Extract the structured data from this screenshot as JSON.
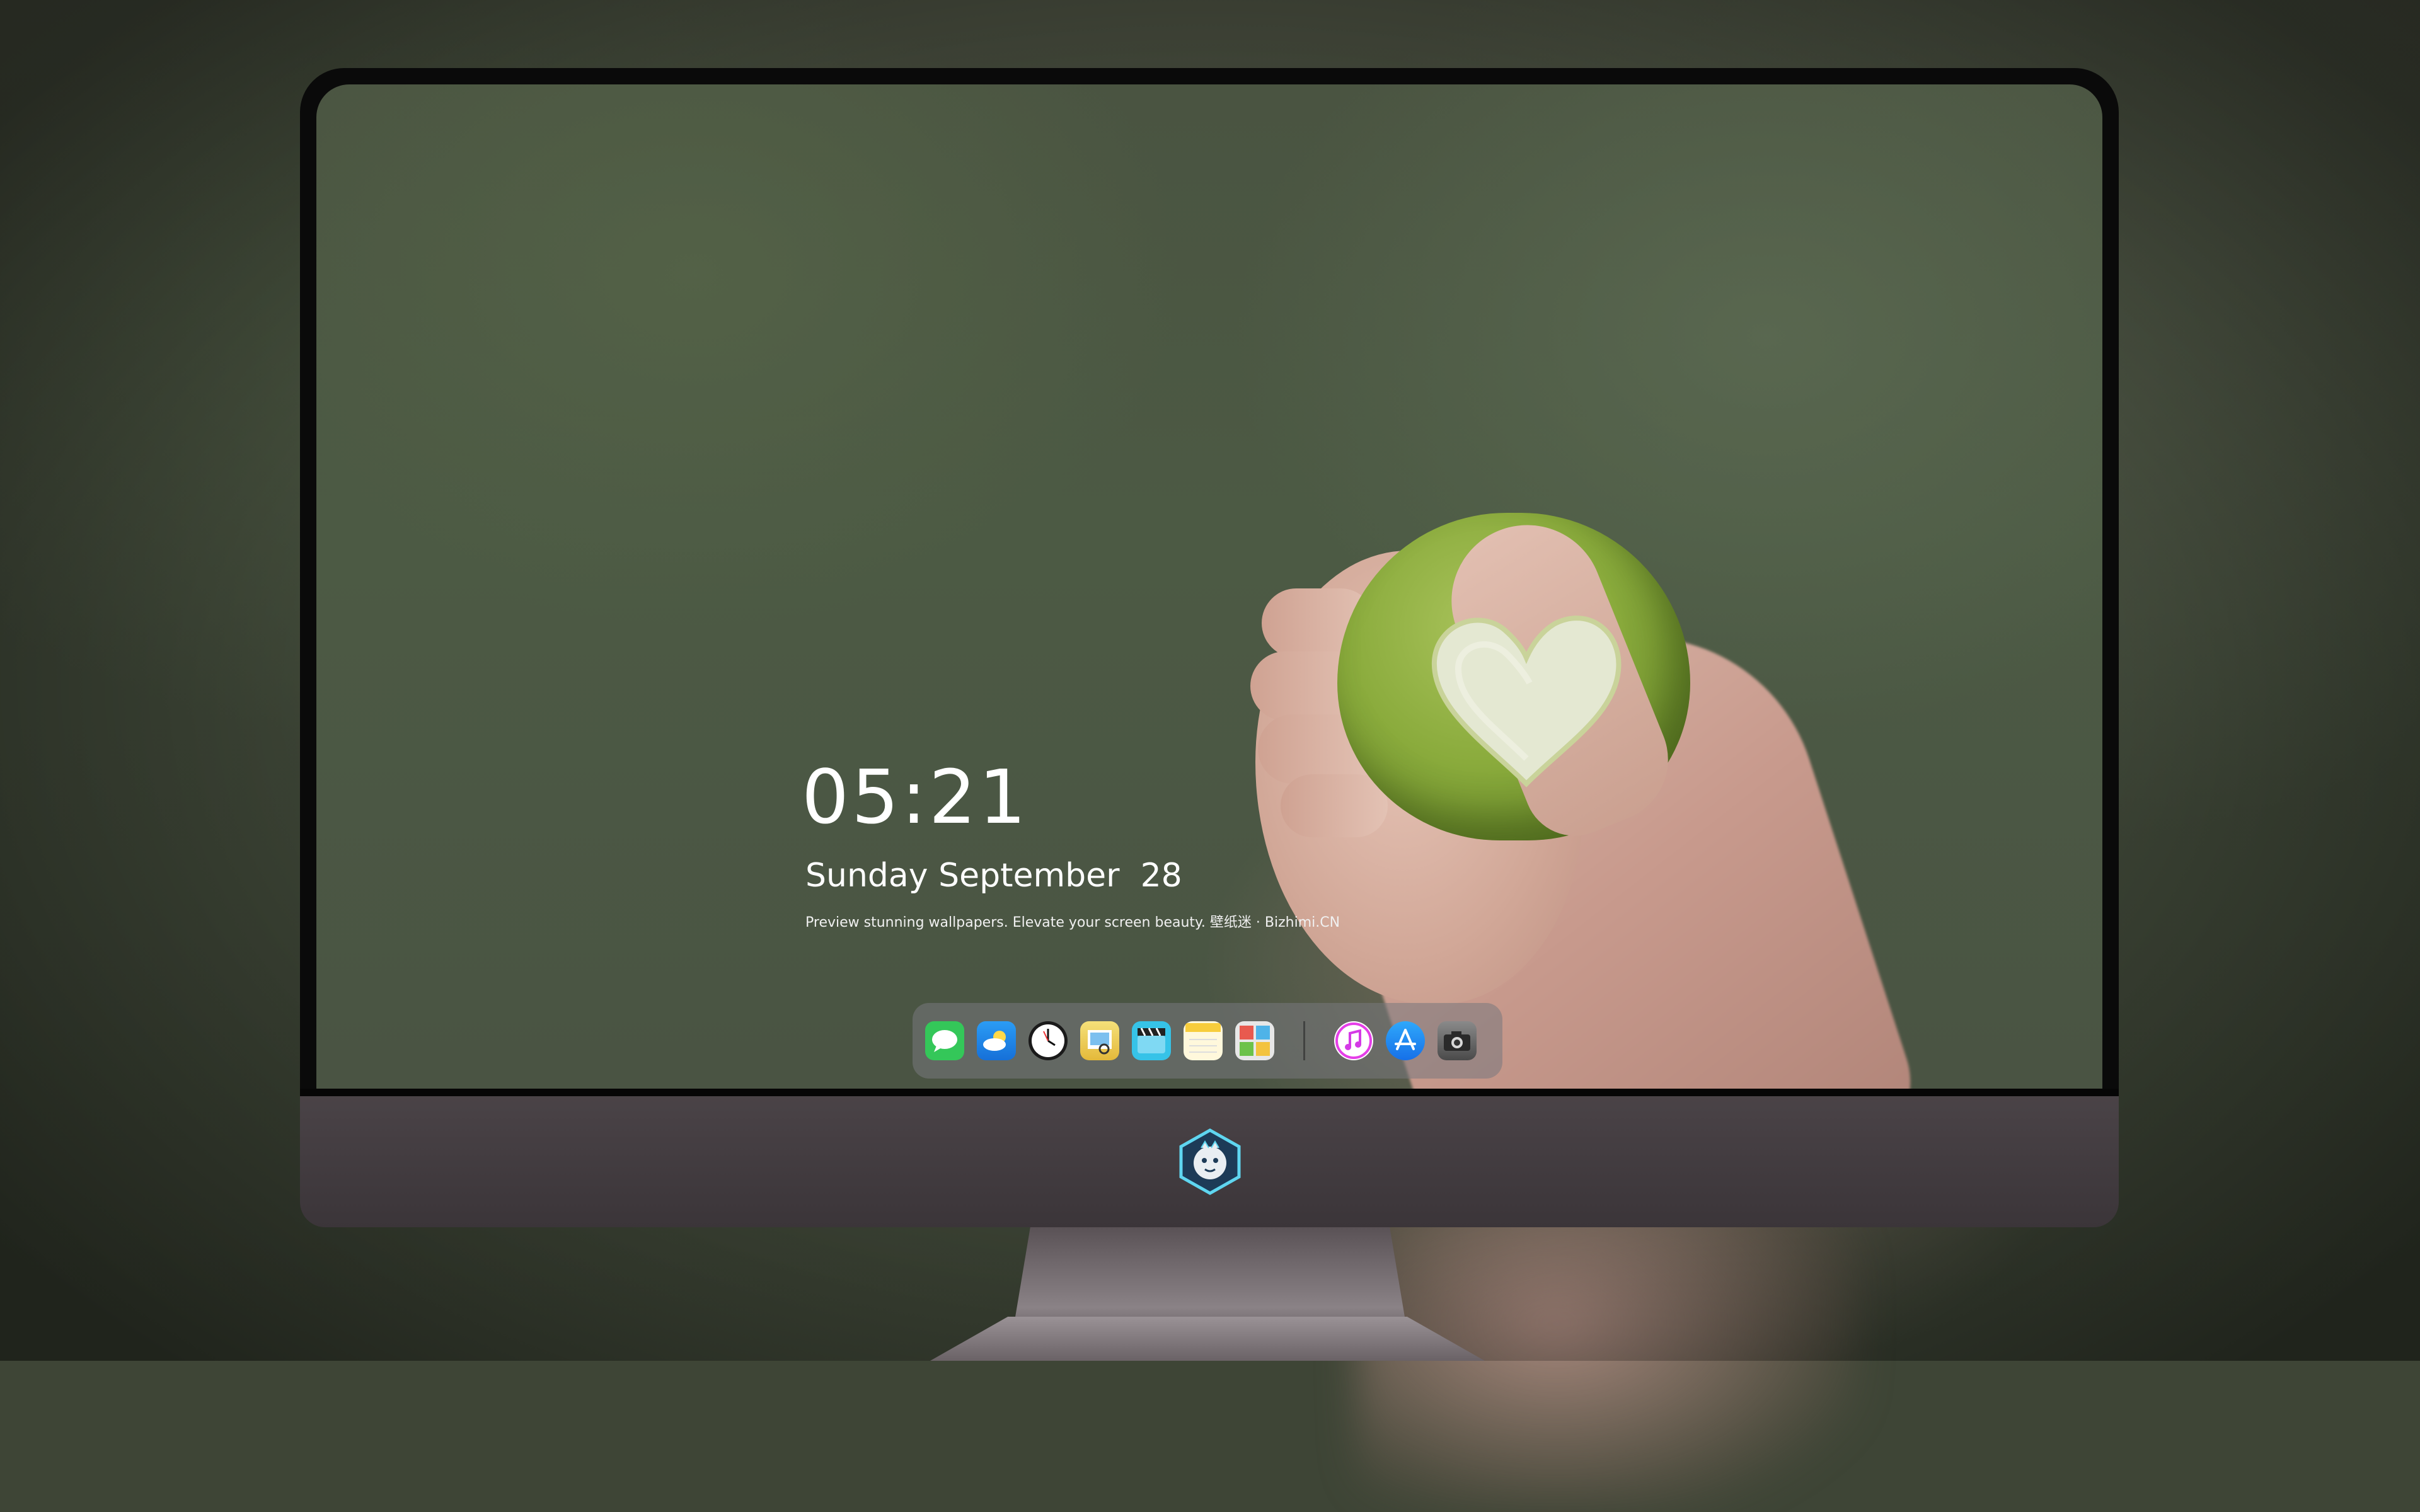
{
  "lock_screen": {
    "time": "05:21",
    "date": "Sunday September  28",
    "tagline": "Preview stunning wallpapers. Elevate your screen beauty. 壁纸迷 · Bizhimi.CN"
  },
  "dock": {
    "apps": [
      {
        "name": "messages-icon",
        "color": "#34c759"
      },
      {
        "name": "weather-icon",
        "color": "#1e8ef0"
      },
      {
        "name": "clock-icon",
        "color": "#1a1a1a"
      },
      {
        "name": "preview-icon",
        "color": "#f4d34a"
      },
      {
        "name": "clips-icon",
        "color": "#36c3e8"
      },
      {
        "name": "notes-icon",
        "color": "#fbe06a"
      },
      {
        "name": "photo-booth-icon",
        "color": "#e7e7e7"
      },
      {
        "name": "itunes-icon",
        "color": "#e53ee8"
      },
      {
        "name": "app-store-icon",
        "color": "#1c8ef5"
      },
      {
        "name": "camera-icon",
        "color": "#3a3a3a"
      }
    ]
  },
  "chin": {
    "logo": "mascot-logo-icon"
  }
}
